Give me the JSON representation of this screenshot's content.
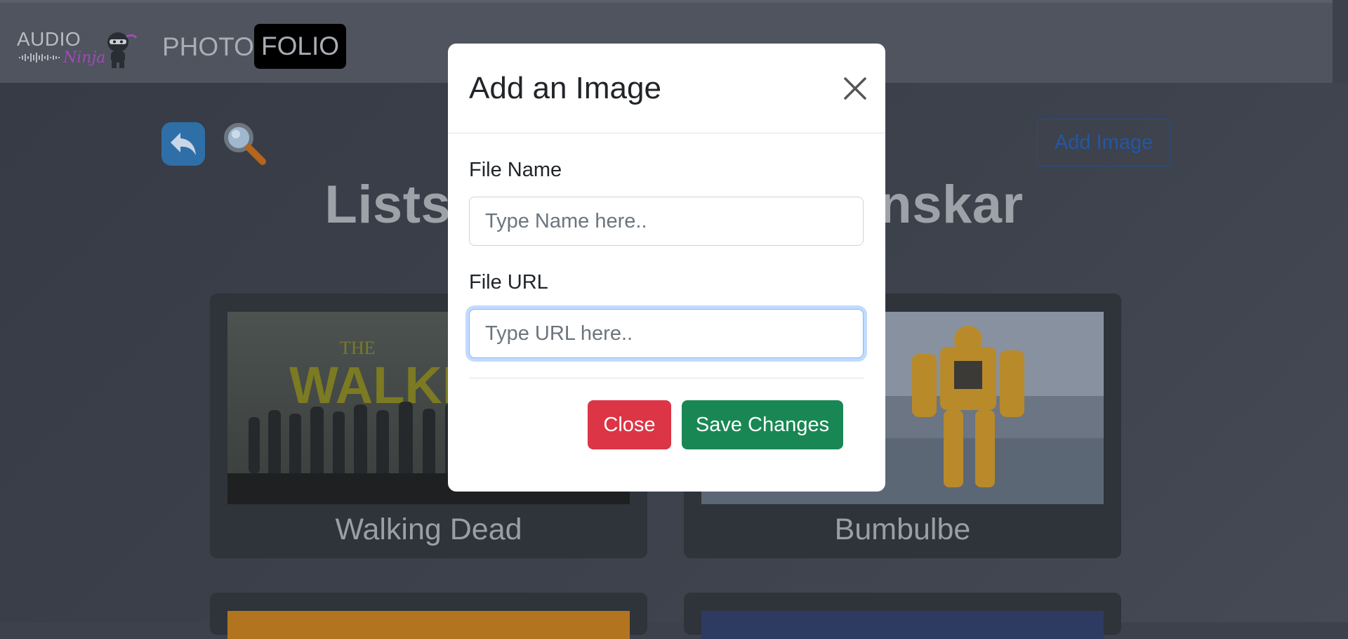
{
  "navbar": {
    "logo": {
      "word_audio": "AUDIO",
      "word_ninja": "Ninja"
    },
    "brand_photo": "PHOTO",
    "brand_folio": "FOLIO"
  },
  "toolbar": {
    "back_icon": "reply-arrow-icon",
    "search_icon": "magnifier-icon",
    "add_image_label": "Add Image"
  },
  "page": {
    "heading_left": "Lists",
    "heading_right": "nskar"
  },
  "cards": [
    {
      "caption": "Walking Dead",
      "image_text": "THE WALKING"
    },
    {
      "caption": "Bumbulbe"
    }
  ],
  "modal": {
    "title": "Add an Image",
    "close_icon": "close-x-icon",
    "fields": {
      "name": {
        "label": "File Name",
        "placeholder": "Type Name here..",
        "value": ""
      },
      "url": {
        "label": "File URL",
        "placeholder": "Type URL here..",
        "value": ""
      }
    },
    "buttons": {
      "close": "Close",
      "save": "Save Changes"
    }
  },
  "colors": {
    "close_button": "#dc3545",
    "save_button": "#198754",
    "focus_ring": "#86b7fe",
    "add_image_outline": "#1c4f98",
    "back_button": "#2f6fa8"
  }
}
